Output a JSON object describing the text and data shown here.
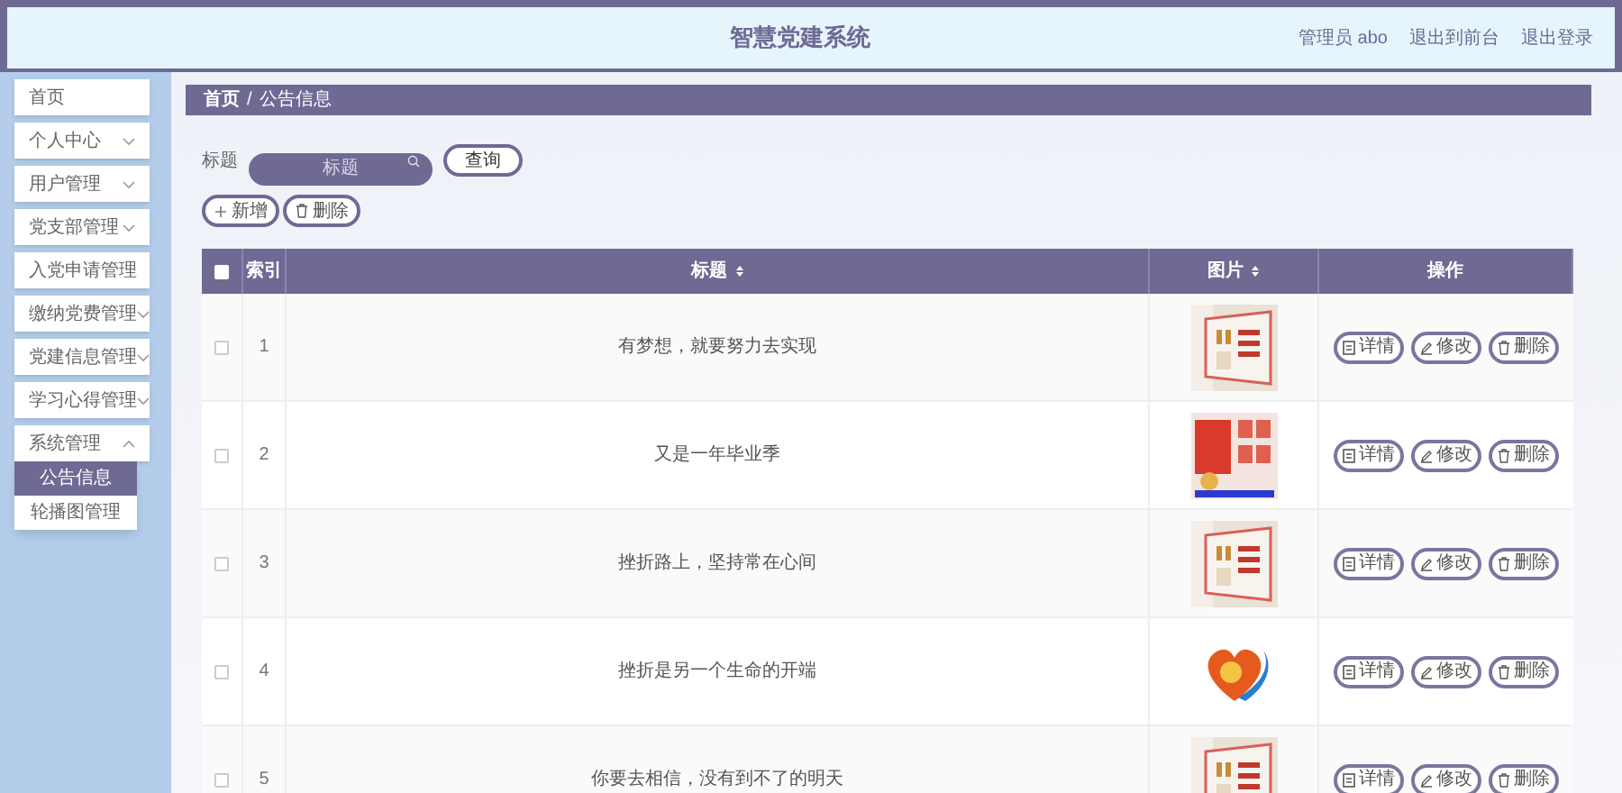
{
  "header": {
    "title": "智慧党建系统",
    "links": [
      "管理员 abo",
      "退出到前台",
      "退出登录"
    ]
  },
  "sidebar": {
    "items": [
      {
        "label": "首页",
        "kind": "link"
      },
      {
        "label": "个人中心",
        "kind": "menu",
        "expanded": false
      },
      {
        "label": "用户管理",
        "kind": "menu",
        "expanded": false
      },
      {
        "label": "党支部管理",
        "kind": "menu",
        "expanded": false
      },
      {
        "label": "入党申请管理",
        "kind": "link"
      },
      {
        "label": "缴纳党费管理",
        "kind": "menu",
        "expanded": false
      },
      {
        "label": "党建信息管理",
        "kind": "menu",
        "expanded": false
      },
      {
        "label": "学习心得管理",
        "kind": "menu",
        "expanded": false
      },
      {
        "label": "系统管理",
        "kind": "menu",
        "expanded": true,
        "children": [
          {
            "label": "公告信息",
            "selected": true
          },
          {
            "label": "轮播图管理",
            "selected": false
          }
        ]
      }
    ]
  },
  "breadcrumb": [
    "首页",
    "/",
    "公告信息"
  ],
  "search": {
    "label": "标题",
    "placeholder": "标题",
    "button": "查询"
  },
  "toolbar": [
    "新增",
    "删除"
  ],
  "table": {
    "all_checked": false,
    "columns": [
      {
        "label": "索引",
        "sortable": false
      },
      {
        "label": "标题",
        "sortable": true
      },
      {
        "label": "图片",
        "sortable": true
      },
      {
        "label": "操作",
        "sortable": false
      }
    ],
    "rows": [
      {
        "index": "1",
        "title": "有梦想，就要努力去实现",
        "checked": false,
        "actions": [
          "详情",
          "修改",
          "删除"
        ]
      },
      {
        "index": "2",
        "title": "又是一年毕业季",
        "checked": false,
        "actions": [
          "详情",
          "修改",
          "删除"
        ]
      },
      {
        "index": "3",
        "title": "挫折路上，坚持常在心间",
        "checked": false,
        "actions": [
          "详情",
          "修改",
          "删除"
        ]
      },
      {
        "index": "4",
        "title": "挫折是另一个生命的开端",
        "checked": false,
        "actions": [
          "详情",
          "修改",
          "删除"
        ]
      },
      {
        "index": "5",
        "title": "你要去相信，没有到不了的明天",
        "checked": false,
        "actions": [
          "详情",
          "修改",
          "删除"
        ]
      }
    ]
  }
}
